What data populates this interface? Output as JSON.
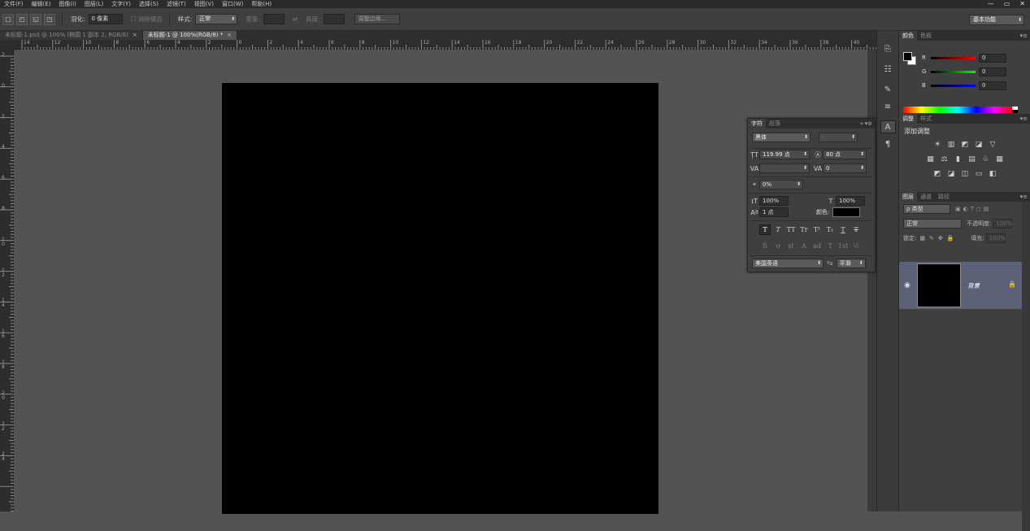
{
  "menu": [
    "文件(F)",
    "编辑(E)",
    "图像(I)",
    "图层(L)",
    "文字(Y)",
    "选择(S)",
    "滤镜(T)",
    "视图(V)",
    "窗口(W)",
    "帮助(H)"
  ],
  "window_controls": [
    "—",
    "▭",
    "✕"
  ],
  "options": {
    "feather_label": "羽化:",
    "feather_value": "0 像素",
    "antialias_label": "消除锯齿",
    "style_label": "样式:",
    "style_value": "正常",
    "width_label": "宽度:",
    "height_label": "高度:",
    "refine_button": "调整边缘...",
    "workspace": "基本功能"
  },
  "tabs": [
    {
      "label": "未标题-1.psd @ 100% (椭圆 1 副本 2, RGB/8)",
      "close": "×"
    },
    {
      "label": "未标题-1 @ 100%(RGB/8) *",
      "close": "×"
    }
  ],
  "ruler": {
    "h_ticks": [
      "14",
      "12",
      "10",
      "8",
      "6",
      "4",
      "2",
      "0",
      "2",
      "4",
      "6",
      "8",
      "10",
      "12",
      "14",
      "16",
      "18",
      "20",
      "22",
      "24",
      "26",
      "28",
      "30",
      "32",
      "34",
      "36",
      "38",
      "40"
    ],
    "v_ticks": [
      "2",
      "0",
      "2",
      "4",
      "6",
      "8",
      "1 0",
      "1 2",
      "1 4",
      "1 6",
      "1 8",
      "2 0",
      "2 2",
      "2 4"
    ]
  },
  "color_panel": {
    "tabs": [
      "颜色",
      "色板"
    ],
    "channels": [
      {
        "label": "R",
        "value": "0",
        "color": "#ff0000"
      },
      {
        "label": "G",
        "value": "0",
        "color": "#00c000"
      },
      {
        "label": "B",
        "value": "0",
        "color": "#2020ff"
      }
    ]
  },
  "adjust_panel": {
    "tabs": [
      "调整",
      "样式"
    ],
    "title": "添加调整",
    "rows": [
      [
        "☀",
        "▥",
        "◩",
        "◪",
        "▽"
      ],
      [
        "▦",
        "⚖",
        "▮",
        "▤",
        "♧",
        "▦"
      ],
      [
        "◩",
        "◪",
        "◫",
        "▭",
        "◧"
      ]
    ]
  },
  "layers_panel": {
    "tabs": [
      "图层",
      "通道",
      "路径"
    ],
    "kind_filter": "ρ 类型",
    "blend_mode": "正常",
    "opacity_label": "不透明度:",
    "opacity_value": "100%",
    "lock_label": "锁定:",
    "fill_label": "填充:",
    "fill_value": "100%",
    "layer": {
      "name": "背景",
      "visible_icon": "eye-icon"
    }
  },
  "char_panel": {
    "tabs": [
      "字符",
      "段落"
    ],
    "collapse": "»",
    "font_family": "黑体",
    "font_style": "-",
    "font_size": "119.99 点",
    "leading": "80 点",
    "kerning": "",
    "tracking": "0",
    "tsume": "0%",
    "vscale": "100%",
    "hscale": "100%",
    "baseline": "1 点",
    "color_label": "颜色:",
    "text_color": "#000000",
    "style_buttons": [
      "T",
      "T",
      "TT",
      "Tr",
      "T¹",
      "T₁",
      "T",
      "T"
    ],
    "ot_buttons": [
      "fi",
      "ơ",
      "st",
      "A",
      "ad",
      "T",
      "1st",
      "½"
    ],
    "language": "美国英语",
    "aa_label": "ªa",
    "antialias": "平滑"
  }
}
